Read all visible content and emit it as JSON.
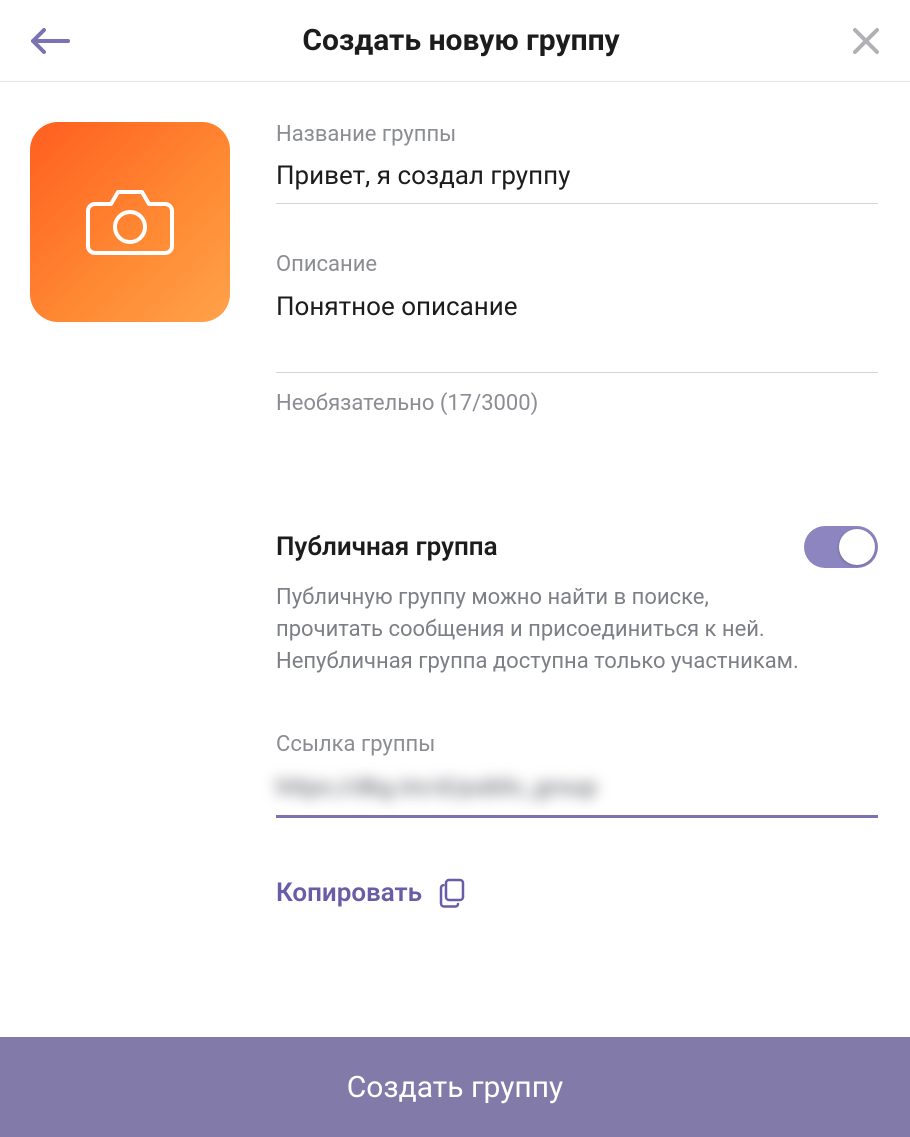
{
  "header": {
    "title": "Создать новую группу"
  },
  "group_name": {
    "label": "Название группы",
    "value": "Привет, я создал группу"
  },
  "description": {
    "label": "Описание",
    "value": "Понятное описание",
    "hint": "Необязательно (17/3000)"
  },
  "public_group": {
    "title": "Публичная группа",
    "enabled": true,
    "description": "Публичную группу можно найти в поиске, прочитать сообщения и присоединиться к ней. Непубличная группа доступна только участникам."
  },
  "group_link": {
    "label": "Ссылка группы",
    "value": "https://dkg.im/d/public_group"
  },
  "copy": {
    "label": "Копировать"
  },
  "submit": {
    "label": "Создать группу"
  },
  "colors": {
    "accent": "#6a5da8",
    "toggle": "#8c85bf",
    "submit_bg": "#827ba9",
    "avatar_gradient_start": "#ff5e1f",
    "avatar_gradient_end": "#ffa24a"
  }
}
